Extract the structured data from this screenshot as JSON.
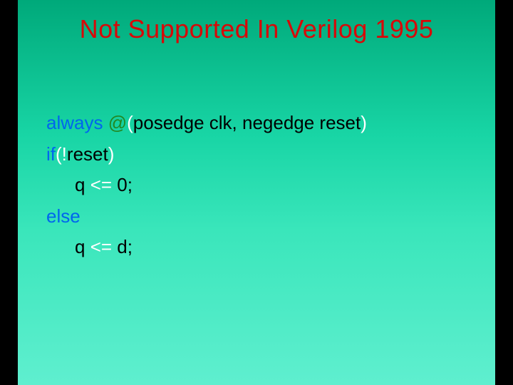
{
  "title": "Not Supported In Verilog 1995",
  "code": {
    "line1": {
      "always": "always ",
      "at": "@",
      "paren_open": "(",
      "args": "posedge clk, negedge reset",
      "paren_close": ")"
    },
    "line2": {
      "if_kw": "if",
      "paren_open": "(",
      "bang": "!",
      "reset": "reset",
      "paren_close": ")"
    },
    "line3": {
      "q": "q ",
      "op": "<=",
      "rest": " 0;"
    },
    "line4": {
      "else_kw": "else"
    },
    "line5": {
      "q": "q ",
      "op": "<=",
      "rest": " d;"
    }
  }
}
